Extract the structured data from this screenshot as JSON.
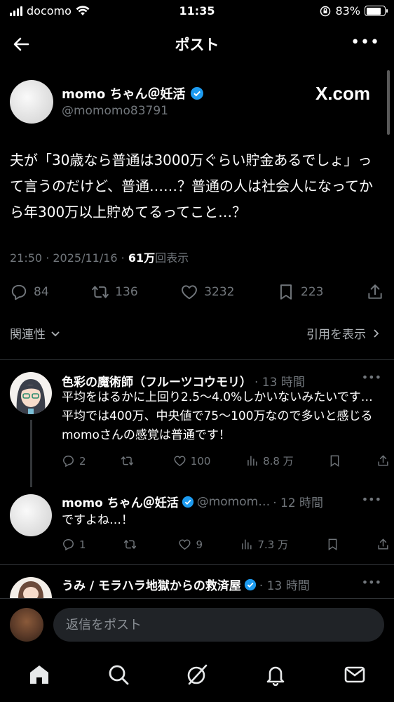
{
  "status": {
    "carrier": "docomo",
    "time": "11:35",
    "battery": "83%"
  },
  "nav": {
    "title": "ポスト"
  },
  "post": {
    "name": "momo ちゃん＠妊活",
    "handle": "@momomo83791",
    "badge": "X.com",
    "text": "夫が「30歳なら普通は3000万ぐらい貯金あるでしょ」って言うのだけど、普通……？普通の人は社会人になってから年300万以上貯めてるってこと…？",
    "time": "21:50 · 2025/11/16 · ",
    "views": "61万",
    "views_label": "回表示",
    "replies": "84",
    "reposts": "136",
    "likes": "3232",
    "bookmarks": "223"
  },
  "filters": {
    "relevance": "関連性",
    "quotes": "引用を表示"
  },
  "replies": [
    {
      "name": "色彩の魔術師（フルーツコウモリ）",
      "time": "· 13 時間",
      "text": "平均をはるかに上回り2.5〜4.0%しかいないみたいです…平均では400万、中央値で75〜100万なので多いと感じるmomoさんの感覚は普通です！",
      "replies": "2",
      "reposts": "",
      "likes": "100",
      "views": "8.8 万"
    },
    {
      "name": "momo ちゃん＠妊活",
      "handle": "@momom…",
      "time": "· 12 時間",
      "text": "ですよね…！",
      "replies": "1",
      "reposts": "",
      "likes": "9",
      "views": "7.3 万"
    },
    {
      "name": "うみ / モラハラ地獄からの救済屋",
      "time": "· 13 時間"
    }
  ],
  "reply_box": {
    "placeholder": "返信をポスト"
  },
  "colors": {
    "background": "#000000",
    "text": "#e7e9ea",
    "muted": "#71767b",
    "verified": "#1d9bf0"
  },
  "tabs": [
    "home-icon",
    "search-icon",
    "grok-icon",
    "notifications-icon",
    "messages-icon"
  ]
}
